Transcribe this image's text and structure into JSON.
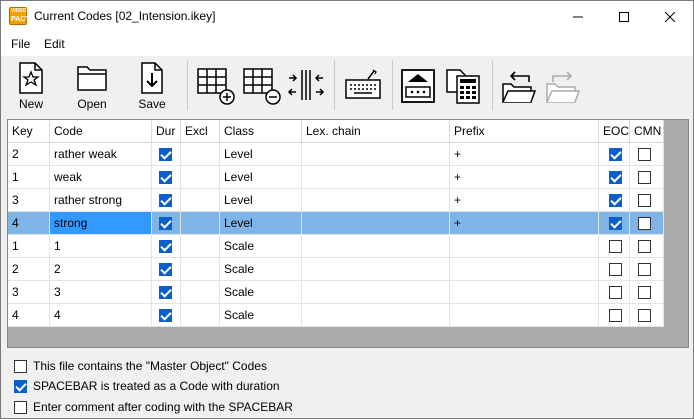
{
  "window": {
    "title": "Current Codes [02_Intension.ikey]",
    "app_icon": {
      "line1": "VIDEO",
      "line2": "PACT"
    }
  },
  "menu": {
    "items": [
      {
        "label": "File"
      },
      {
        "label": "Edit"
      }
    ]
  },
  "toolbar": {
    "new_label": "New",
    "open_label": "Open",
    "save_label": "Save",
    "icons": [
      "new-file-icon",
      "open-folder-icon",
      "save-download-icon",
      "add-row-icon",
      "remove-row-icon",
      "split-columns-icon",
      "keyboard-icon",
      "print-icon",
      "calculator-list-icon",
      "undo-folder-icon",
      "redo-folder-icon"
    ]
  },
  "grid": {
    "columns": [
      "Key",
      "Code",
      "Dur",
      "Excl",
      "Class",
      "Lex. chain",
      "Prefix",
      "EOC",
      "CMN"
    ],
    "rows": [
      {
        "key": "2",
        "code": "rather weak",
        "dur": true,
        "excl": "",
        "class": "Level",
        "lex": "",
        "prefix": "+",
        "eoc": true,
        "cmn": false,
        "selected": false
      },
      {
        "key": "1",
        "code": "weak",
        "dur": true,
        "excl": "",
        "class": "Level",
        "lex": "",
        "prefix": "+",
        "eoc": true,
        "cmn": false,
        "selected": false
      },
      {
        "key": "3",
        "code": "rather strong",
        "dur": true,
        "excl": "",
        "class": "Level",
        "lex": "",
        "prefix": "+",
        "eoc": true,
        "cmn": false,
        "selected": false
      },
      {
        "key": "4",
        "code": "strong",
        "dur": true,
        "excl": "",
        "class": "Level",
        "lex": "",
        "prefix": "+",
        "eoc": true,
        "cmn": false,
        "selected": true
      },
      {
        "key": "1",
        "code": "1",
        "dur": true,
        "excl": "",
        "class": "Scale",
        "lex": "",
        "prefix": "",
        "eoc": false,
        "cmn": false,
        "selected": false
      },
      {
        "key": "2",
        "code": "2",
        "dur": true,
        "excl": "",
        "class": "Scale",
        "lex": "",
        "prefix": "",
        "eoc": false,
        "cmn": false,
        "selected": false
      },
      {
        "key": "3",
        "code": "3",
        "dur": true,
        "excl": "",
        "class": "Scale",
        "lex": "",
        "prefix": "",
        "eoc": false,
        "cmn": false,
        "selected": false
      },
      {
        "key": "4",
        "code": "4",
        "dur": true,
        "excl": "",
        "class": "Scale",
        "lex": "",
        "prefix": "",
        "eoc": false,
        "cmn": false,
        "selected": false
      }
    ]
  },
  "options": [
    {
      "label": "This file contains the \"Master Object\" Codes",
      "checked": false
    },
    {
      "label": "SPACEBAR is treated as a Code with duration",
      "checked": true
    },
    {
      "label": "Enter comment after coding with the SPACEBAR",
      "checked": false
    }
  ],
  "colors": {
    "selected_row": "#7fb4e6",
    "selected_cell": "#3399ff",
    "checkbox_checked": "#0a5fcb",
    "app_icon": "#f5a000"
  }
}
